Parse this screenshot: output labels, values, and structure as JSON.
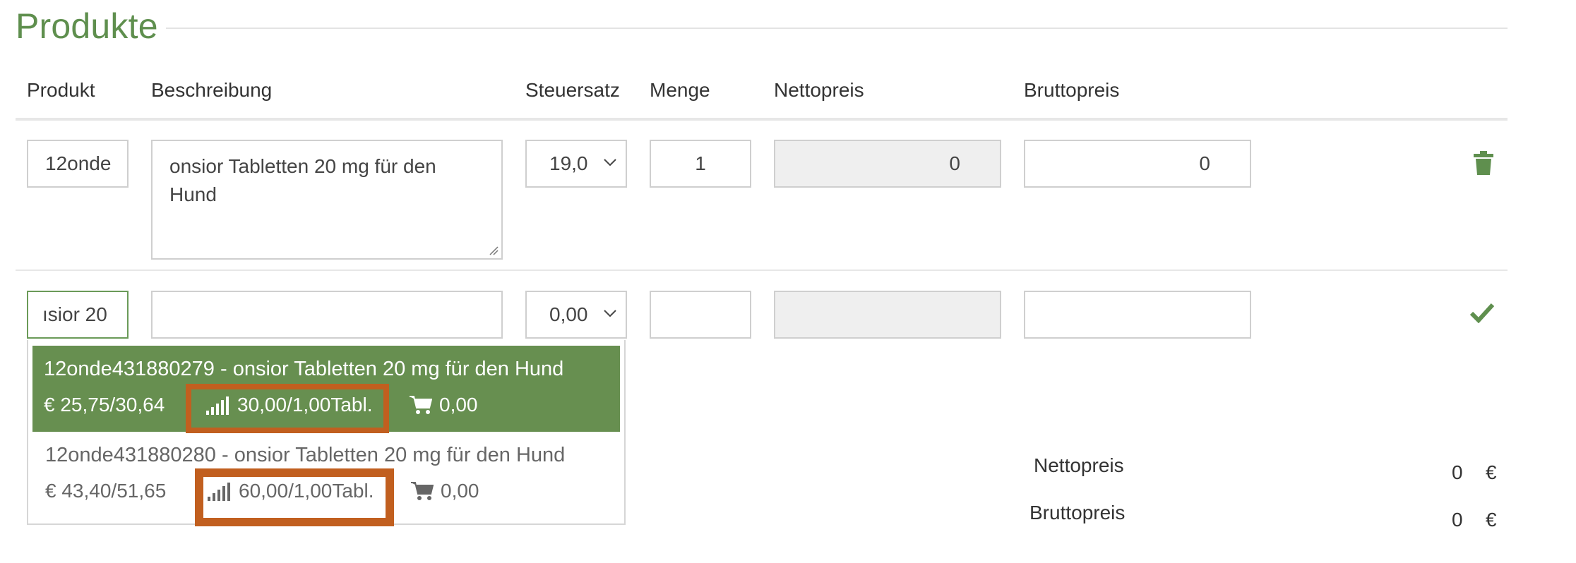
{
  "section": {
    "title": "Produkte"
  },
  "columns": {
    "produkt": "Produkt",
    "beschreibung": "Beschreibung",
    "steuersatz": "Steuersatz",
    "menge": "Menge",
    "nettopreis": "Nettopreis",
    "bruttopreis": "Bruttopreis"
  },
  "rows": [
    {
      "produkt": "12onde",
      "beschreibung": "onsior Tabletten 20 mg für den Hund",
      "steuersatz": "19,0",
      "menge": "1",
      "nettopreis": "0",
      "bruttopreis": "0",
      "action_icon": "trash-icon"
    },
    {
      "produkt": "ısior 20",
      "beschreibung": "",
      "steuersatz": "0,00",
      "menge": "",
      "nettopreis": "",
      "bruttopreis": "",
      "action_icon": "check-icon"
    }
  ],
  "suggestions": [
    {
      "title": "12onde431880279 - onsior Tabletten 20 mg für den Hund",
      "price": "25,75/30,64",
      "tier": "30,00/1,00Tabl.",
      "cart": "0,00",
      "selected": true
    },
    {
      "title": "12onde431880280 - onsior Tabletten 20 mg für den Hund",
      "price": "43,40/51,65",
      "tier": "60,00/1,00Tabl.",
      "cart": "0,00",
      "selected": false
    }
  ],
  "summary": {
    "netto_label": "Nettopreis",
    "netto_value": "0",
    "brutto_label": "Bruttopreis",
    "brutto_value": "0",
    "currency": "€"
  },
  "colors": {
    "accent": "#5f8f4e",
    "selected_bg": "#678f50",
    "highlight": "#c15f1f"
  }
}
